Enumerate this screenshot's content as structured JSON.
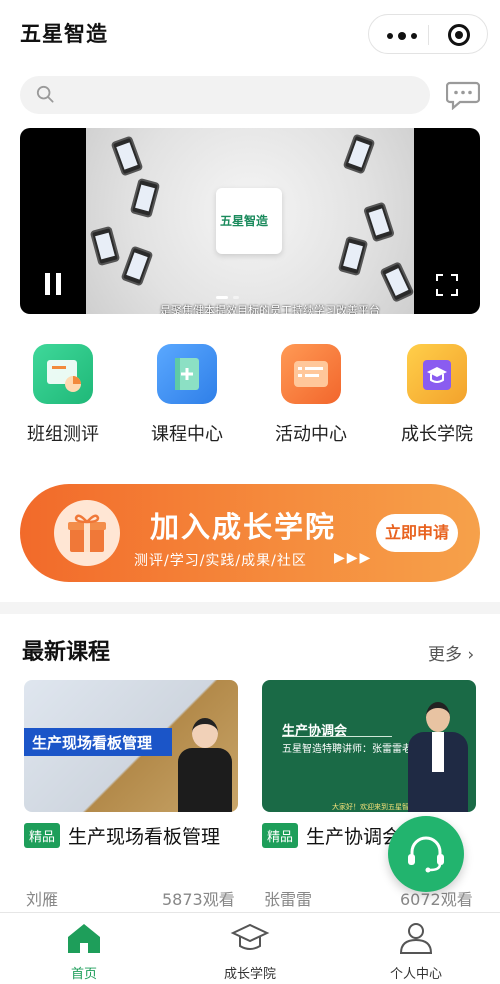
{
  "header": {
    "title": "五星智造"
  },
  "banner": {
    "logo_text": "五星智造",
    "caption": "是聚焦健本提效目标的员工持续学习改善平台"
  },
  "features": [
    {
      "label": "班组测评",
      "icon": "clipboard-chart-icon",
      "color": "#2fcb8c"
    },
    {
      "label": "课程中心",
      "icon": "book-plus-icon",
      "color": "#3b8ef3"
    },
    {
      "label": "活动中心",
      "icon": "activity-list-icon",
      "color": "#f5773a"
    },
    {
      "label": "成长学院",
      "icon": "graduation-cap-icon",
      "color": "#f4b43a"
    }
  ],
  "promo": {
    "title": "加入成长学院",
    "subtitle": "测评/学习/实践/成果/社区",
    "arrows": "▶▶▶",
    "button": "立即申请"
  },
  "latest": {
    "title": "最新课程",
    "more": "更多 ›"
  },
  "courses": [
    {
      "thumb_title": "生产现场看板管理",
      "tag": "精品",
      "title": "生产现场看板管理",
      "teacher": "刘雁",
      "views": "5873观看"
    },
    {
      "thumb_title": "生产协调会",
      "thumb_sub": "五星智造特聘讲师：张雷雷老师",
      "thumb_note": "大家好！欢迎来到五星智造学习平台",
      "tag": "精品",
      "title": "生产协调会",
      "teacher": "张雷雷",
      "views": "6072观看"
    }
  ],
  "tabs": [
    {
      "label": "首页",
      "icon": "home-icon",
      "active": true
    },
    {
      "label": "成长学院",
      "icon": "graduation-cap-icon",
      "active": false
    },
    {
      "label": "个人中心",
      "icon": "user-icon",
      "active": false
    }
  ],
  "colors": {
    "accent": "#1e9e5a",
    "promo": "#f26a2a"
  }
}
